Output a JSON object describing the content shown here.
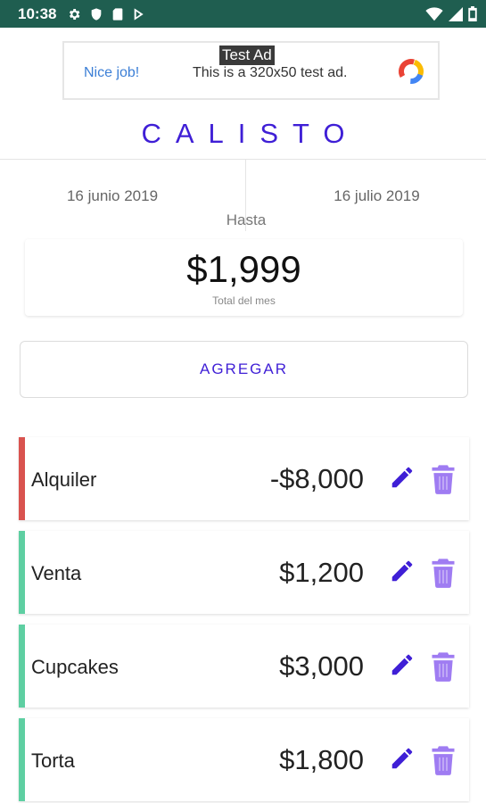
{
  "status_bar": {
    "time": "10:38",
    "left_icons": [
      "gear-icon",
      "shield-icon",
      "sd-card-icon",
      "play-store-icon"
    ],
    "right_icons": [
      "wifi-icon",
      "signal-icon",
      "battery-icon"
    ]
  },
  "ad": {
    "label": "Test Ad",
    "nice": "Nice job!",
    "text": "This is a 320x50 test ad.",
    "logo_icon": "ad-logo-icon"
  },
  "app": {
    "title": "CALISTO"
  },
  "period": {
    "from": "16 junio 2019",
    "to": "16 julio 2019",
    "until_label": "Hasta"
  },
  "total": {
    "amount": "$1,999",
    "caption": "Total del mes"
  },
  "add_button": {
    "label": "AGREGAR"
  },
  "colors": {
    "accent": "#3f1fd6",
    "status_bar": "#1f5e50",
    "expense": "#d9534f",
    "income": "#5ecfa2",
    "delete_icon": "#9f7cf2"
  },
  "transactions": [
    {
      "name": "Alquiler",
      "amount": "-$8,000",
      "type": "expense"
    },
    {
      "name": "Venta",
      "amount": "$1,200",
      "type": "income"
    },
    {
      "name": "Cupcakes",
      "amount": "$3,000",
      "type": "income"
    },
    {
      "name": "Torta",
      "amount": "$1,800",
      "type": "income"
    }
  ]
}
